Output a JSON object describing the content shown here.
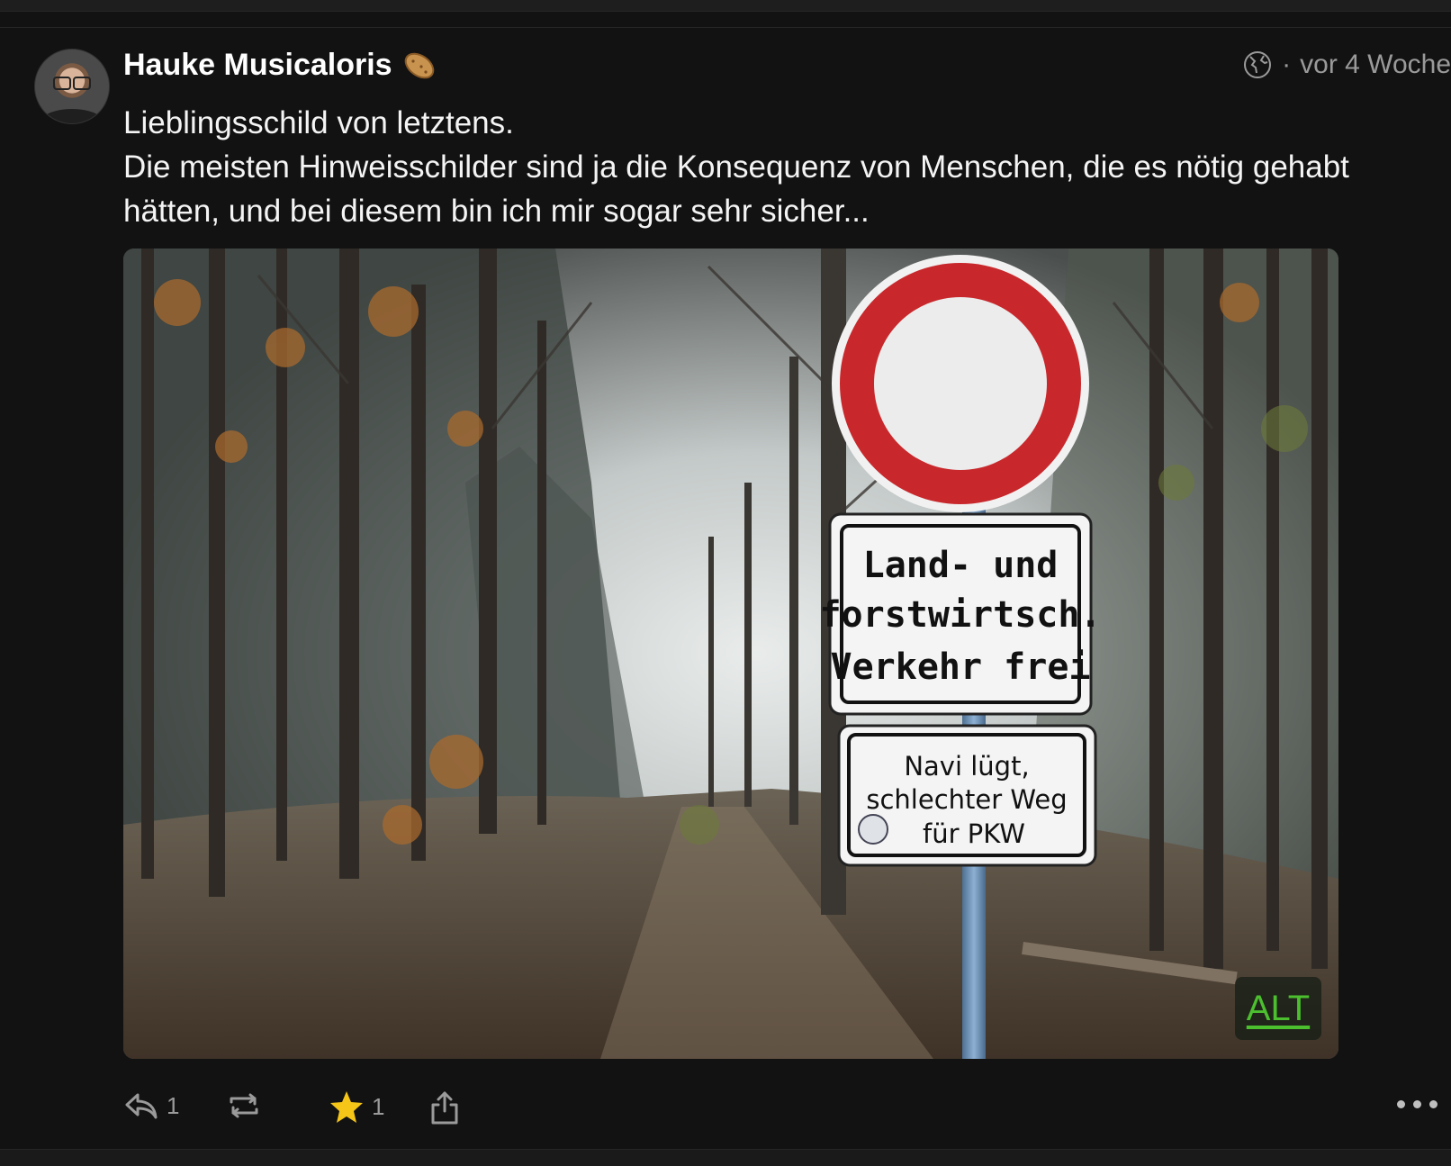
{
  "post": {
    "author": {
      "name": "Hauke Musicaloris",
      "emoji_icon": "potato-emoji-icon"
    },
    "visibility_icon": "globe-icon",
    "separator": "·",
    "timestamp": "vor 4 Woche",
    "text_lines": [
      "Lieblingsschild von letztens.",
      "Die meisten Hinweisschilder sind ja die Konsequenz von Menschen, die es nötig gehabt hätten, und bei diesem bin ich mir sogar sehr sicher..."
    ],
    "media": {
      "sign_main_lines": [
        "Land- und",
        "forstwirtsch.",
        "Verkehr frei"
      ],
      "sign_extra_lines": [
        "Navi lügt,",
        "schlechter Weg",
        "für PKW"
      ],
      "alt_label": "ALT"
    },
    "actions": {
      "reply_count": "1",
      "favourite_count": "1"
    }
  },
  "colors": {
    "background": "#121212",
    "text": "#f4f4f4",
    "muted": "#9a9a9a",
    "alt_green": "#4cbf2f",
    "star": "#f5c518"
  }
}
